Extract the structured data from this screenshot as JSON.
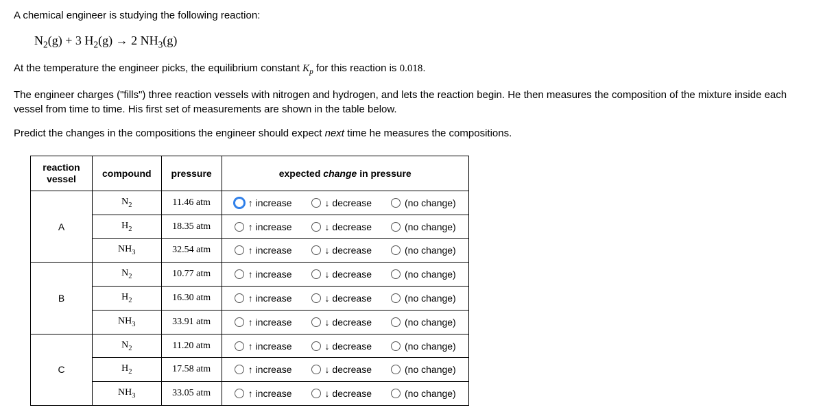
{
  "intro": {
    "line1": "A chemical engineer is studying the following reaction:",
    "equation_html": "N<sub>2</sub>(g) + 3 H<sub>2</sub>(g) → 2 NH<sub>3</sub>(g)",
    "line2_pre": "At the temperature the engineer picks, the equilibrium constant ",
    "line2_kp": "K<sub>p</sub>",
    "line2_mid": " for this reaction is ",
    "kp_value": "0.018",
    "line2_post": ".",
    "line3": "The engineer charges (\"fills\") three reaction vessels with nitrogen and hydrogen, and lets the reaction begin. He then measures the composition of the mixture inside each vessel from time to time. His first set of measurements are shown in the table below.",
    "line4_pre": "Predict the changes in the compositions the engineer should expect ",
    "line4_em": "next",
    "line4_post": " time he measures the compositions."
  },
  "headers": {
    "vessel": "reaction vessel",
    "compound": "compound",
    "pressure": "pressure",
    "expected_pre": "expected ",
    "expected_em": "change",
    "expected_post": " in pressure"
  },
  "options": {
    "increase": "↑ increase",
    "decrease": "↓ decrease",
    "nochange": "(no change)"
  },
  "vessels": [
    {
      "name": "A",
      "rows": [
        {
          "compound": "N<sub>2</sub>",
          "pressure": "11.46 atm",
          "focused": true
        },
        {
          "compound": "H<sub>2</sub>",
          "pressure": "18.35 atm",
          "focused": false
        },
        {
          "compound": "NH<sub>3</sub>",
          "pressure": "32.54 atm",
          "focused": false
        }
      ]
    },
    {
      "name": "B",
      "rows": [
        {
          "compound": "N<sub>2</sub>",
          "pressure": "10.77 atm",
          "focused": false
        },
        {
          "compound": "H<sub>2</sub>",
          "pressure": "16.30 atm",
          "focused": false
        },
        {
          "compound": "NH<sub>3</sub>",
          "pressure": "33.91 atm",
          "focused": false
        }
      ]
    },
    {
      "name": "C",
      "rows": [
        {
          "compound": "N<sub>2</sub>",
          "pressure": "11.20 atm",
          "focused": false
        },
        {
          "compound": "H<sub>2</sub>",
          "pressure": "17.58 atm",
          "focused": false
        },
        {
          "compound": "NH<sub>3</sub>",
          "pressure": "33.05 atm",
          "focused": false
        }
      ]
    }
  ]
}
